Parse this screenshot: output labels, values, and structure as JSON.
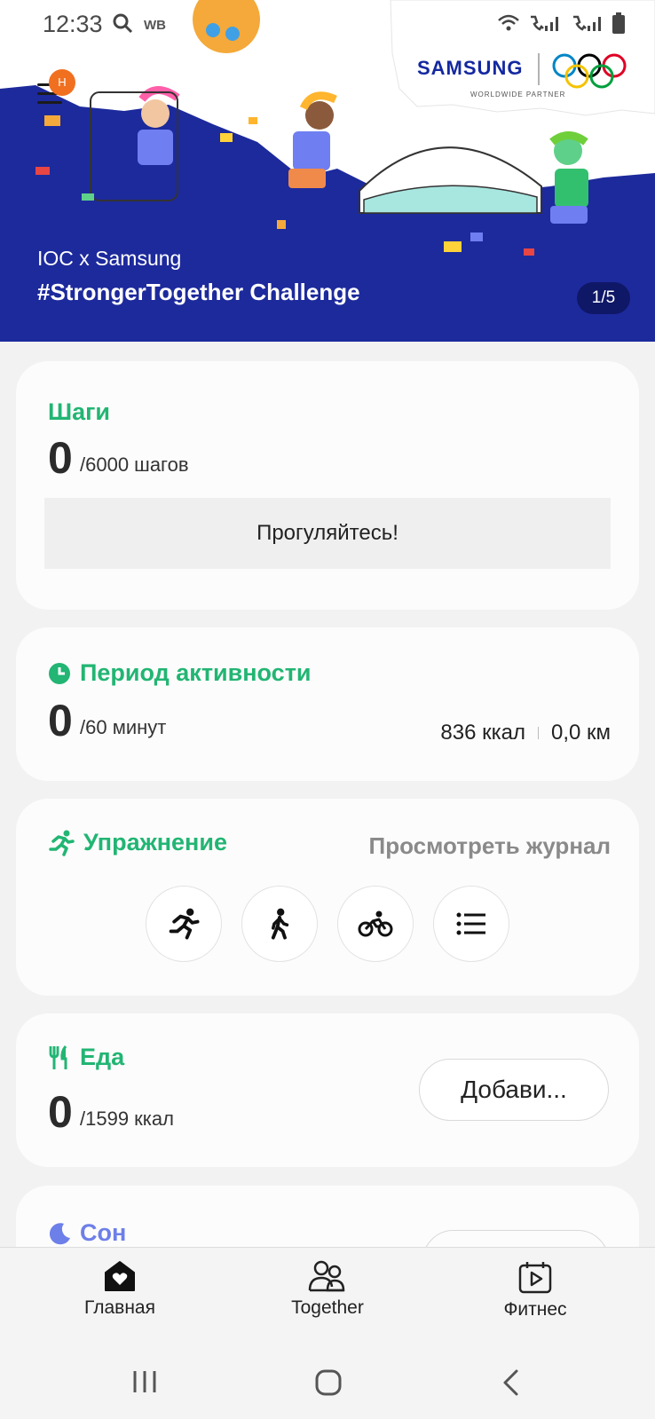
{
  "status_bar": {
    "time": "12:33",
    "wb_label": "WB"
  },
  "banner": {
    "subtitle": "IOC x Samsung",
    "title": "#StrongerTogether Challenge",
    "page_indicator": "1/5",
    "menu_badge": "H",
    "partner_brand": "SAMSUNG",
    "partner_caption": "WORLDWIDE PARTNER"
  },
  "steps": {
    "title": "Шаги",
    "value": "0",
    "goal": "/6000 шагов",
    "button": "Прогуляйтесь!"
  },
  "active": {
    "title": "Период активности",
    "value": "0",
    "goal": "/60 минут",
    "kcal": "836 ккал",
    "distance": "0,0 км"
  },
  "exercise": {
    "title": "Упражнение",
    "view_log": "Просмотреть журнал",
    "icons": [
      "running-icon",
      "walking-icon",
      "cycling-icon",
      "list-icon"
    ]
  },
  "food": {
    "title": "Еда",
    "value": "0",
    "goal": "/1599 ккал",
    "add_button": "Добави..."
  },
  "sleep": {
    "title": "Сон"
  },
  "bottom_nav": {
    "home": "Главная",
    "together": "Together",
    "fitness": "Фитнес"
  },
  "colors": {
    "accent_green": "#22b573",
    "sleep_blue": "#6d7fe8",
    "banner_blue": "#1d2a9c",
    "badge_orange": "#f07020"
  }
}
